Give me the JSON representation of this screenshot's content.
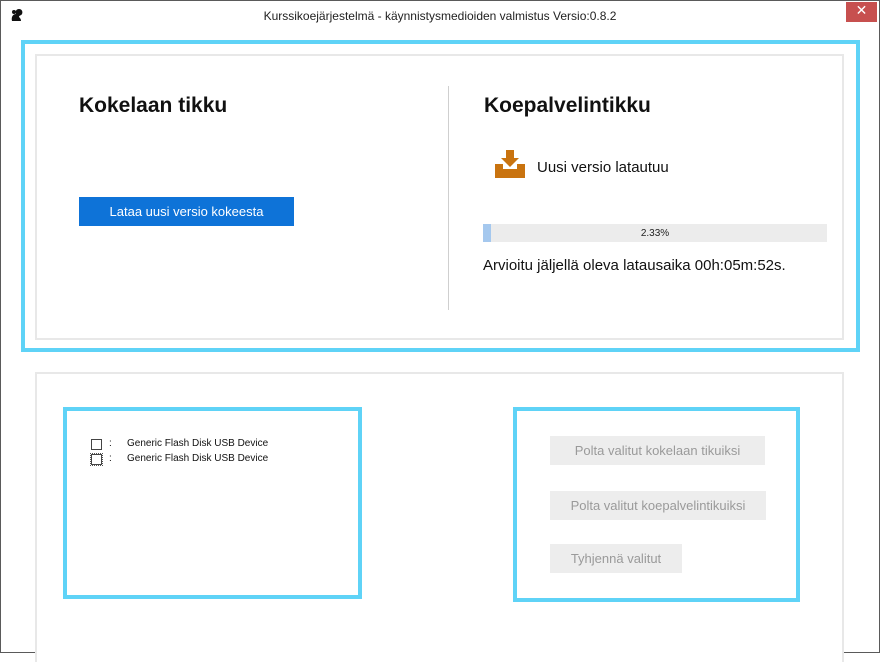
{
  "window": {
    "title": "Kurssikoejärjestelmä - käynnistysmedioiden valmistus Versio:0.8.2",
    "close_label": "✕",
    "app_icon": "squirrel-icon"
  },
  "kokelas": {
    "heading": "Kokelaan tikku",
    "download_button": "Lataa uusi versio kokeesta"
  },
  "koepalvelin": {
    "heading": "Koepalvelintikku",
    "status_icon": "download-icon",
    "status_text": "Uusi versio latautuu",
    "progress_percent": 2.33,
    "progress_label": "2.33%",
    "eta_text": "Arvioitu jäljellä oleva latausaika 00h:05m:52s."
  },
  "devices": [
    {
      "separator": ":",
      "label": "Generic Flash Disk USB Device",
      "checked": false,
      "focused": false
    },
    {
      "separator": ":",
      "label": "Generic Flash Disk USB Device",
      "checked": false,
      "focused": true
    }
  ],
  "actions": {
    "burn_kokelas": "Polta valitut kokelaan tikuiksi",
    "burn_koepalvelin": "Polta valitut koepalvelintikuiksi",
    "clear": "Tyhjennä valitut"
  },
  "colors": {
    "frame": "#5fd3f7",
    "primary_button": "#0e73d8",
    "close_button": "#c7504f",
    "download_icon": "#c9730f",
    "progress_fill": "#a5c8ee"
  }
}
